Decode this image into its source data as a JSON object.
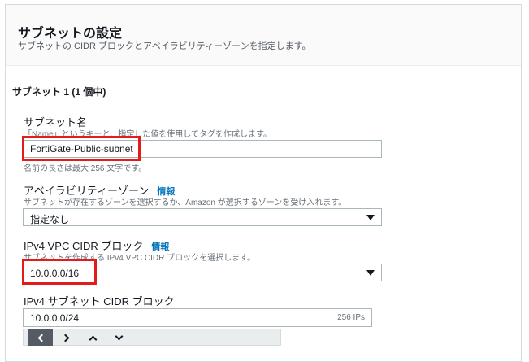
{
  "header": {
    "title": "サブネットの設定",
    "description": "サブネットの CIDR ブロックとアベイラビリティーゾーンを指定します。"
  },
  "subnet_section": {
    "title": "サブネット 1 (1 個中)"
  },
  "subnet_name": {
    "label": "サブネット名",
    "description": "「Name」というキーと、指定した値を使用してタグを作成します。",
    "value": "FortiGate-Public-subnet",
    "hint": "名前の長さは最大 256 文字です。"
  },
  "availability_zone": {
    "label": "アベイラビリティーゾーン",
    "info": "情報",
    "description": "サブネットが存在するゾーンを選択するか、Amazon が選択するゾーンを受け入れます。",
    "selected": "指定なし"
  },
  "vpc_cidr": {
    "label": "IPv4 VPC CIDR ブロック",
    "info": "情報",
    "description": "サブネットを作成する IPv4 VPC CIDR ブロックを選択します。",
    "selected": "10.0.0.0/16"
  },
  "subnet_cidr": {
    "label": "IPv4 サブネット CIDR ブロック",
    "value": "10.0.0.0/24",
    "suffix": "256 IPs"
  },
  "stepper": {
    "buttons": [
      "chevron-left",
      "chevron-right",
      "chevron-up",
      "chevron-down"
    ]
  },
  "colors": {
    "highlight": "#e31b1b",
    "link": "#0073bb",
    "active_step": "#545b64"
  }
}
